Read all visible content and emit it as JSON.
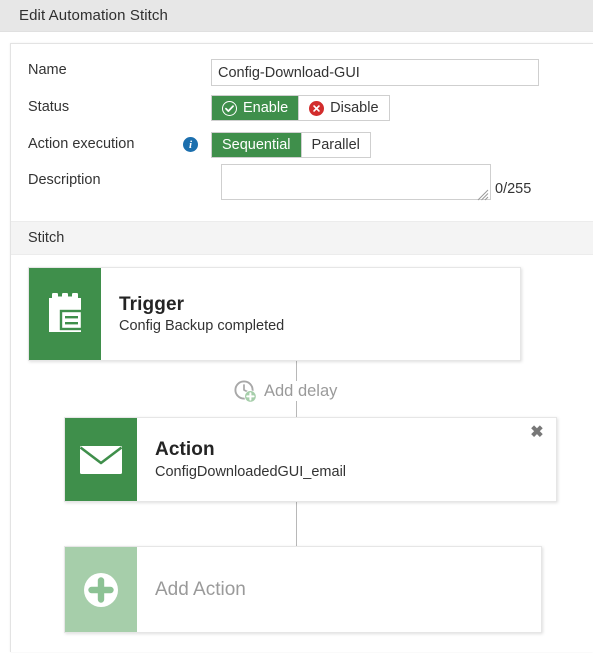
{
  "titlebar": {
    "title": "Edit Automation Stitch"
  },
  "form": {
    "name": {
      "label": "Name",
      "value": "Config-Download-GUI",
      "placeholder": ""
    },
    "status": {
      "label": "Status",
      "options": [
        {
          "label": "Enable",
          "icon": "check-circle-icon",
          "selected": true
        },
        {
          "label": "Disable",
          "icon": "x-circle-icon",
          "selected": false
        }
      ]
    },
    "action_execution": {
      "label": "Action execution",
      "info_icon": "info-icon",
      "info_glyph": "i",
      "options": [
        {
          "label": "Sequential",
          "selected": true
        },
        {
          "label": "Parallel",
          "selected": false
        }
      ]
    },
    "description": {
      "label": "Description",
      "value": "",
      "placeholder": "",
      "counter": "0/255",
      "max_length": 255
    }
  },
  "stitch": {
    "section_label": "Stitch",
    "nodes": [
      {
        "id": "trigger",
        "icon": "clipboard-list-icon",
        "title": "Trigger",
        "subtitle": "Config Backup completed",
        "closable": false
      },
      {
        "id": "action",
        "icon": "envelope-icon",
        "title": "Action",
        "subtitle": "ConfigDownloadedGUI_email",
        "closable": true,
        "close_glyph": "✖"
      },
      {
        "id": "add-action",
        "icon": "plus-circle-icon",
        "placeholder_text": "Add Action",
        "closable": false
      }
    ],
    "add_delay": {
      "label": "Add delay",
      "icon": "clock-plus-icon"
    }
  },
  "colors": {
    "green_primary": "#3f8f4b",
    "green_light": "#a6ceaa",
    "red": "#d22d2d",
    "blue_info": "#1c6fae",
    "titlebar_bg": "#e7e7e7",
    "section_bg": "#f4f4f4",
    "muted_text": "#9a9a9a",
    "connector": "#b8b8b8"
  }
}
